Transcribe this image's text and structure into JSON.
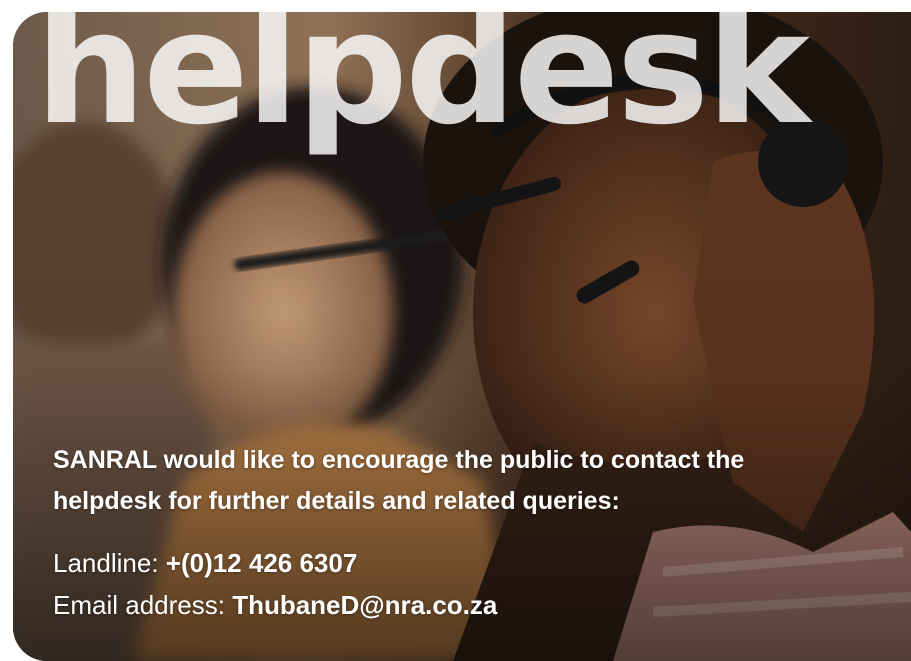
{
  "banner": {
    "headline": "helpdesk",
    "intro": "SANRAL would like to encourage the public to contact the helpdesk for further details and related queries:",
    "landline": {
      "label": "Landline: ",
      "value": "+(0)12 426 6307"
    },
    "email": {
      "label": "Email address: ",
      "value": "ThubaneD@nra.co.za"
    }
  },
  "colors": {
    "text": "#ffffff",
    "headline": "#f0f0f0",
    "photo_dark": "#2b1d12",
    "photo_skin": "#6b4027",
    "photo_bg": "#8a6a4e"
  }
}
